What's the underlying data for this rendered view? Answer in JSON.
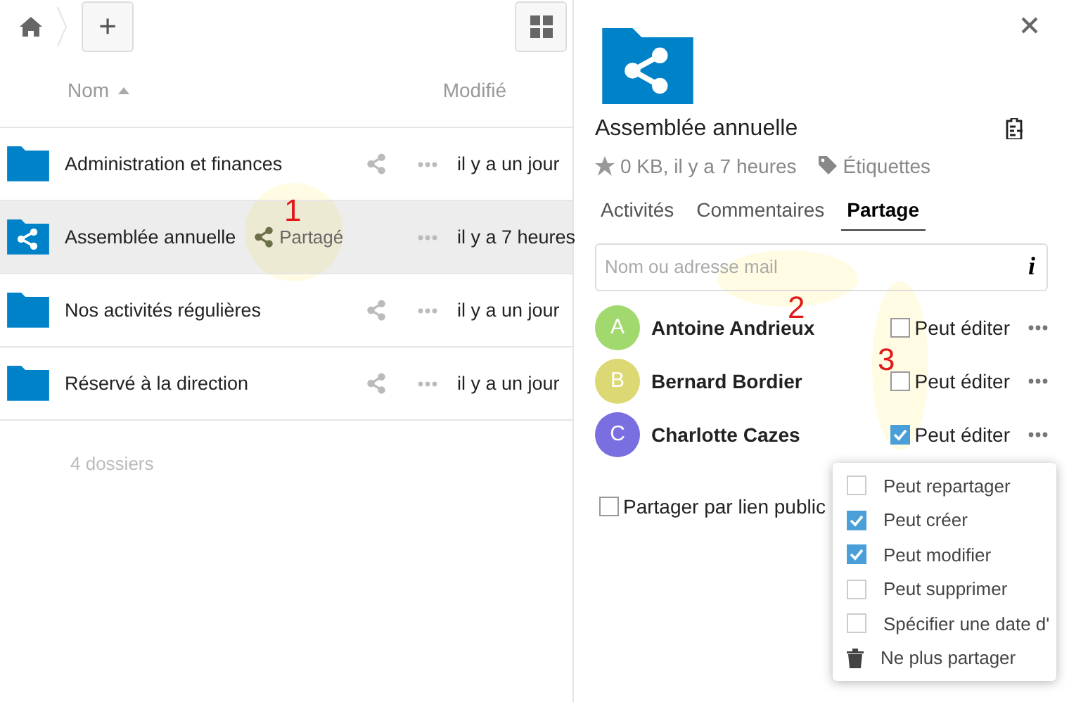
{
  "toolbar": {
    "new_button": "+"
  },
  "file_list": {
    "columns": [
      "Nom",
      "Modifié"
    ],
    "rows": [
      {
        "name": "Administration et finances",
        "shared": false,
        "selected": false,
        "modified": "il y a un jour"
      },
      {
        "name": "Assemblée annuelle",
        "shared": true,
        "share_label": "Partagé",
        "selected": true,
        "modified": "il y a 7 heures"
      },
      {
        "name": "Nos activités régulières",
        "shared": false,
        "selected": false,
        "modified": "il y a un jour"
      },
      {
        "name": "Réservé à la direction",
        "shared": false,
        "selected": false,
        "modified": "il y a un jour"
      }
    ],
    "footer": "4 dossiers"
  },
  "details": {
    "title": "Assemblée annuelle",
    "meta": "0 KB, il y a 7 heures",
    "tags_label": "Étiquettes",
    "tabs": [
      {
        "label": "Activités",
        "selected": false
      },
      {
        "label": "Commentaires",
        "selected": false
      },
      {
        "label": "Partage",
        "selected": true
      }
    ],
    "search": {
      "placeholder": "Nom ou adresse mail"
    },
    "info_button": "i",
    "shares": [
      {
        "initial": "A",
        "name": "Antoine Andrieux",
        "color": "#a2d96f",
        "can_edit": false,
        "permission_label": "Peut éditer"
      },
      {
        "initial": "B",
        "name": "Bernard Bordier",
        "color": "#dcd873",
        "can_edit": false,
        "permission_label": "Peut éditer"
      },
      {
        "initial": "C",
        "name": "Charlotte Cazes",
        "color": "#7a6fe0",
        "can_edit": true,
        "permission_label": "Peut éditer"
      }
    ],
    "menu": {
      "items": [
        {
          "kind": "checkbox",
          "label": "Peut repartager",
          "checked": false
        },
        {
          "kind": "checkbox",
          "label": "Peut créer",
          "checked": true
        },
        {
          "kind": "checkbox",
          "label": "Peut modifier",
          "checked": true
        },
        {
          "kind": "checkbox",
          "label": "Peut supprimer",
          "checked": false
        },
        {
          "kind": "checkbox",
          "label": "Spécifier une date d'",
          "checked": false
        },
        {
          "kind": "action",
          "label": "Ne plus partager"
        }
      ]
    },
    "public_link": {
      "label": "Partager par lien public",
      "checked": false
    }
  },
  "annotations": [
    {
      "label": "1"
    },
    {
      "label": "2"
    },
    {
      "label": "3"
    }
  ]
}
